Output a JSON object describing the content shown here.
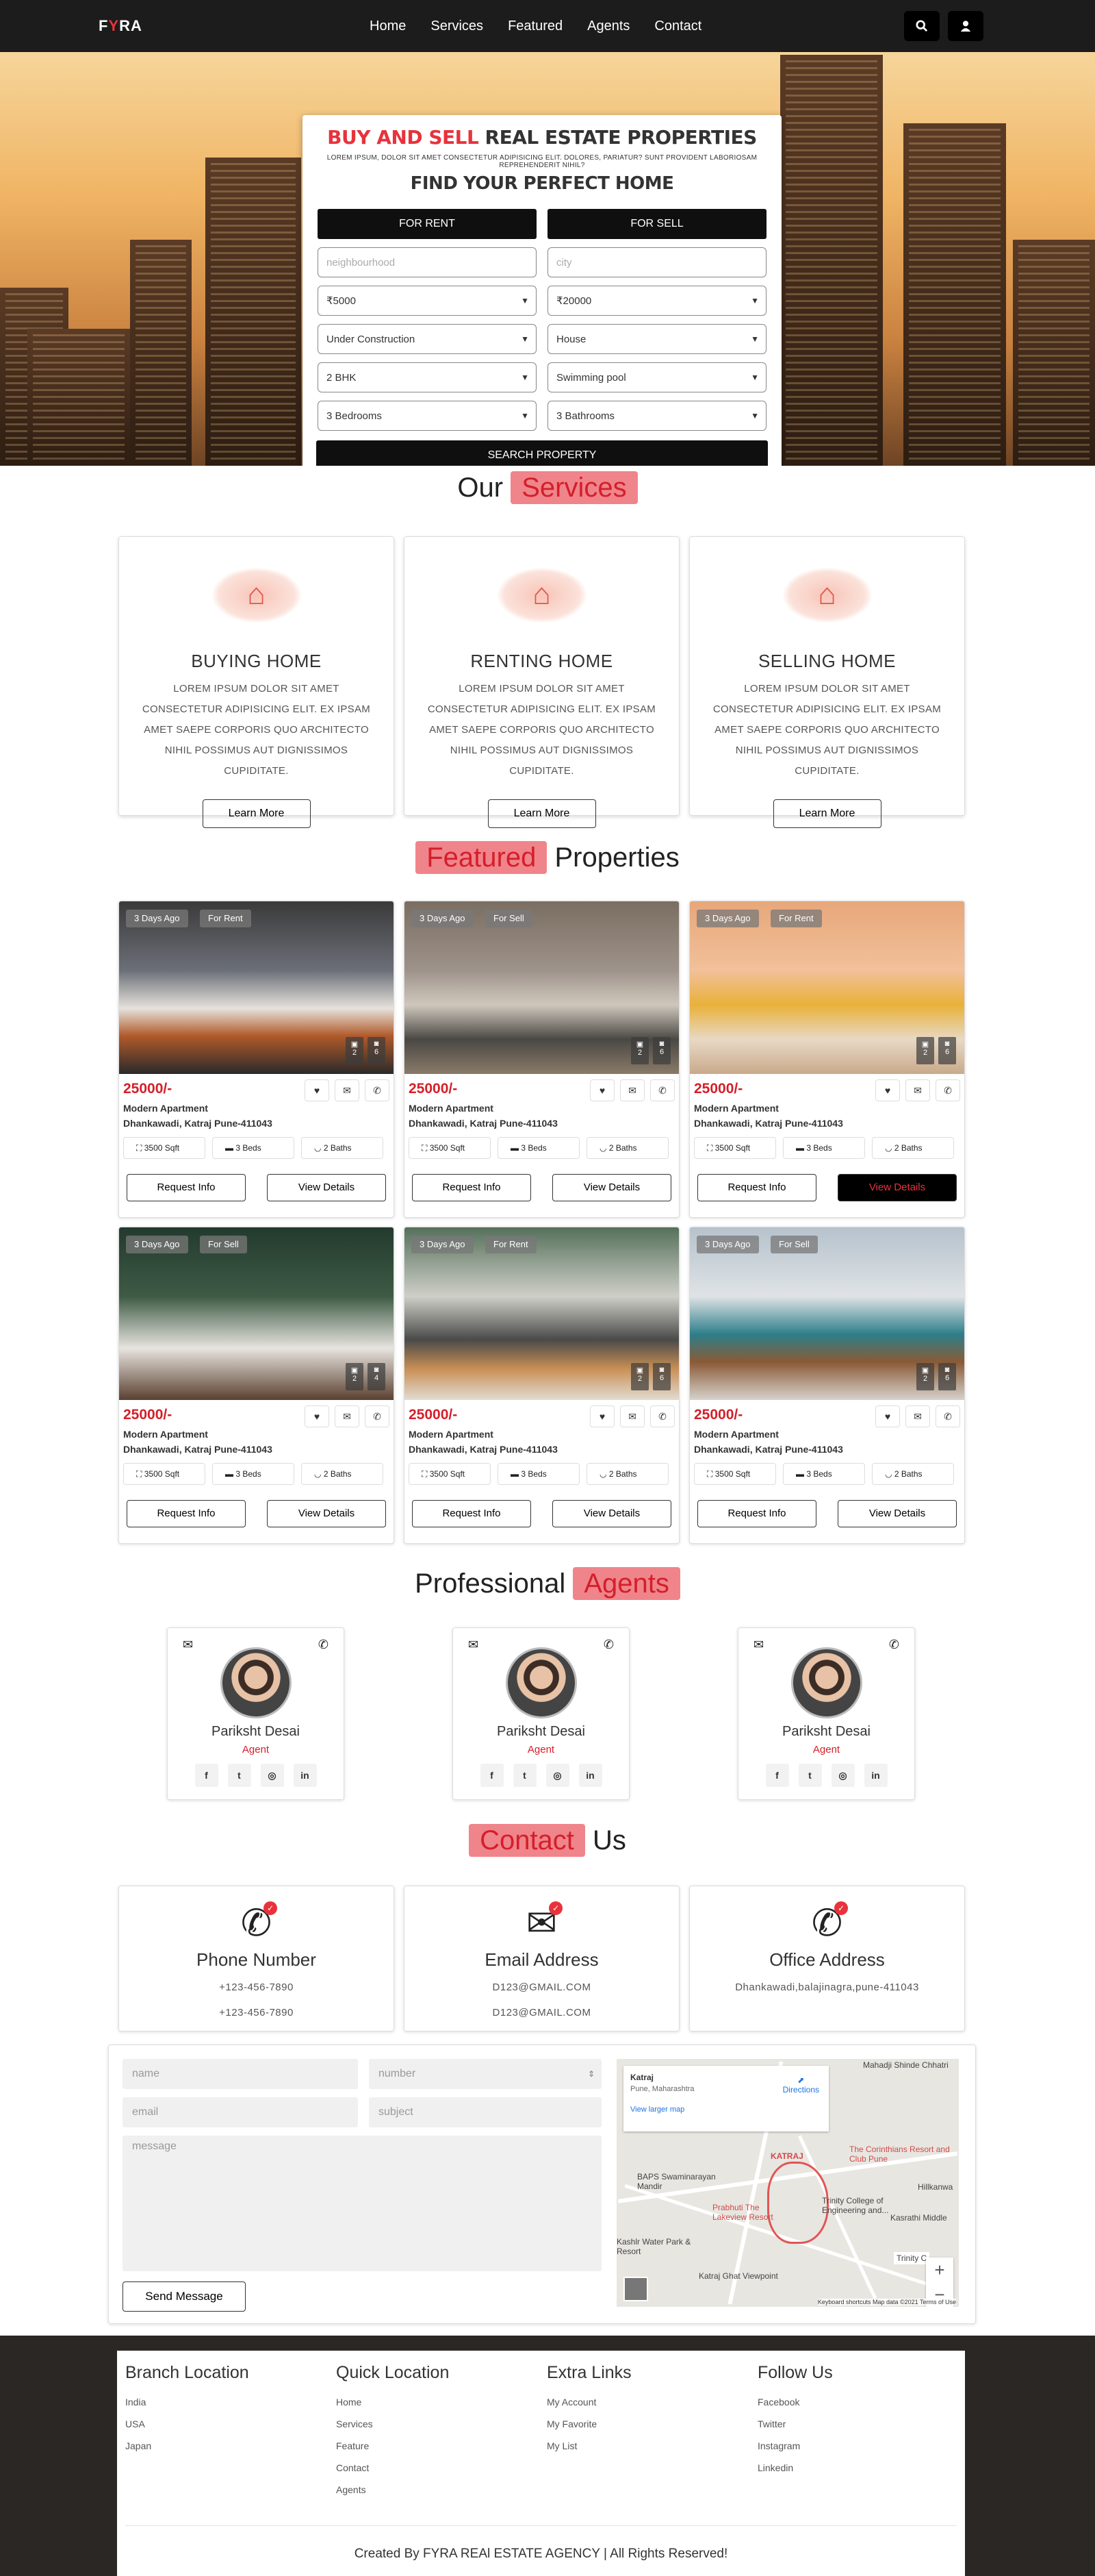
{
  "nav": {
    "logo_pre": "F",
    "logo_mid": "Y",
    "logo_post": "RA",
    "links": [
      "Home",
      "Services",
      "Featured",
      "Agents",
      "Contact"
    ],
    "icons": [
      "search-icon",
      "user-icon"
    ]
  },
  "search": {
    "title_red": "BUY AND SELL",
    "title_rest": " REAL ESTATE PROPERTIES",
    "lorem": "LOREM IPSUM, DOLOR SIT AMET CONSECTETUR ADIPISICING ELIT. DOLORES, PARIATUR? SUNT PROVIDENT LABORIOSAM REPREHENDERIT NIHIL?",
    "subtitle": "FIND YOUR PERFECT HOME",
    "tab_rent": "FOR RENT",
    "tab_sell": "FOR SELL",
    "neighbourhood_placeholder": "neighbourhood",
    "city_placeholder": "city",
    "min_price": "₹5000",
    "max_price": "₹20000",
    "status": "Under Construction",
    "type": "House",
    "bhk": "2 BHK",
    "amenity": "Swimming pool",
    "bedrooms": "3 Bedrooms",
    "bathrooms": "3 Bathrooms",
    "button": "SEARCH PROPERTY"
  },
  "services": {
    "heading_pre": "Our ",
    "heading_hl": "Services",
    "learn_more": "Learn More",
    "items": [
      {
        "title": "BUYING HOME",
        "text": "LOREM IPSUM DOLOR SIT AMET CONSECTETUR ADIPISICING ELIT. EX IPSAM AMET SAEPE CORPORIS QUO ARCHITECTO NIHIL POSSIMUS AUT DIGNISSIMOS CUPIDITATE."
      },
      {
        "title": "RENTING HOME",
        "text": "LOREM IPSUM DOLOR SIT AMET CONSECTETUR ADIPISICING ELIT. EX IPSAM AMET SAEPE CORPORIS QUO ARCHITECTO NIHIL POSSIMUS AUT DIGNISSIMOS CUPIDITATE."
      },
      {
        "title": "SELLING HOME",
        "text": "LOREM IPSUM DOLOR SIT AMET CONSECTETUR ADIPISICING ELIT. EX IPSAM AMET SAEPE CORPORIS QUO ARCHITECTO NIHIL POSSIMUS AUT DIGNISSIMOS CUPIDITATE."
      }
    ]
  },
  "featured": {
    "heading_hl": "Featured",
    "heading_post": " Properties",
    "request": "Request Info",
    "view": "View Details",
    "items": [
      {
        "age": "3 Days Ago",
        "tag": "For Rent",
        "cams": "2",
        "photos": "6",
        "price": "25000/-",
        "name": "Modern Apartment",
        "addr": "Dhankawadi, Katraj Pune-411043",
        "sqft": "3500 Sqft",
        "beds": "3 Beds",
        "baths": "2 Baths"
      },
      {
        "age": "3 Days Ago",
        "tag": "For Sell",
        "cams": "2",
        "photos": "6",
        "price": "25000/-",
        "name": "Modern Apartment",
        "addr": "Dhankawadi, Katraj Pune-411043",
        "sqft": "3500 Sqft",
        "beds": "3 Beds",
        "baths": "2 Baths"
      },
      {
        "age": "3 Days Ago",
        "tag": "For Rent",
        "cams": "2",
        "photos": "6",
        "price": "25000/-",
        "name": "Modern Apartment",
        "addr": "Dhankawadi, Katraj Pune-411043",
        "sqft": "3500 Sqft",
        "beds": "3 Beds",
        "baths": "2 Baths"
      },
      {
        "age": "3 Days Ago",
        "tag": "For Sell",
        "cams": "2",
        "photos": "4",
        "price": "25000/-",
        "name": "Modern Apartment",
        "addr": "Dhankawadi, Katraj Pune-411043",
        "sqft": "3500 Sqft",
        "beds": "3 Beds",
        "baths": "2 Baths"
      },
      {
        "age": "3 Days Ago",
        "tag": "For Rent",
        "cams": "2",
        "photos": "6",
        "price": "25000/-",
        "name": "Modern Apartment",
        "addr": "Dhankawadi, Katraj Pune-411043",
        "sqft": "3500 Sqft",
        "beds": "3 Beds",
        "baths": "2 Baths"
      },
      {
        "age": "3 Days Ago",
        "tag": "For Sell",
        "cams": "2",
        "photos": "6",
        "price": "25000/-",
        "name": "Modern Apartment",
        "addr": "Dhankawadi, Katraj Pune-411043",
        "sqft": "3500 Sqft",
        "beds": "3 Beds",
        "baths": "2 Baths"
      }
    ]
  },
  "agents": {
    "heading_pre": "Professional ",
    "heading_hl": "Agents",
    "items": [
      {
        "name": "Pariksht Desai",
        "role": "Agent"
      },
      {
        "name": "Pariksht Desai",
        "role": "Agent"
      },
      {
        "name": "Pariksht Desai",
        "role": "Agent"
      }
    ]
  },
  "contact": {
    "heading_hl": "Contact",
    "heading_post": " Us",
    "phone": {
      "title": "Phone Number",
      "line1": "+123-456-7890",
      "line2": "+123-456-7890"
    },
    "email": {
      "title": "Email Address",
      "line1": "D123@GMAIL.COM",
      "line2": "D123@GMAIL.COM"
    },
    "office": {
      "title": "Office Address",
      "line1": "Dhankawadi,balajinagra,pune-411043"
    },
    "form": {
      "name_placeholder": "name",
      "number_placeholder": "number",
      "email_placeholder": "email",
      "subject_placeholder": "subject",
      "message_placeholder": "message",
      "send": "Send Message"
    },
    "map": {
      "place": "Katraj",
      "region": "Pune, Maharashtra",
      "directions": "Directions",
      "larger": "View larger map",
      "labels": [
        "Mahadji Shinde Chhatri",
        "KATRAJ",
        "BAPS Swaminarayan Mandir",
        "The Corinthians Resort and Club Pune",
        "Trinity College of Engineering and...",
        "Prabhuti The Lakeview Resort",
        "Kashlr Water Park & Resort",
        "Katraj Ghat Viewpoint",
        "Hillkanwa",
        "Kasrathi Middle",
        "Trinity C"
      ],
      "footer": "Keyboard shortcuts   Map data ©2021   Terms of Use"
    }
  },
  "footer": {
    "cols": [
      {
        "title": "Branch Location",
        "items": [
          "India",
          "USA",
          "Japan"
        ]
      },
      {
        "title": "Quick Location",
        "items": [
          "Home",
          "Services",
          "Feature",
          "Contact",
          "Agents"
        ]
      },
      {
        "title": "Extra Links",
        "items": [
          "My Account",
          "My Favorite",
          "My List"
        ]
      },
      {
        "title": "Follow Us",
        "items": [
          "Facebook",
          "Twitter",
          "Instagram",
          "Linkedin"
        ]
      }
    ],
    "copyright": "Created By FYRA REAl ESTATE AGENCY | All Rights Reserved!"
  },
  "colors": {
    "accent": "#e8323c",
    "highlight": "#f0848b",
    "dark": "#0f0f0f"
  }
}
